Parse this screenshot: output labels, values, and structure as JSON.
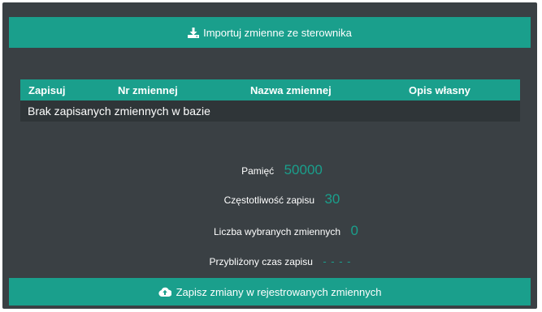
{
  "import_button": {
    "label": "Importuj zmienne ze sterownika",
    "icon": "download-icon"
  },
  "table": {
    "headers": [
      "Zapisuj",
      "Nr zmiennej",
      "Nazwa zmiennej",
      "Opis własny"
    ],
    "empty_message": "Brak zapisanych zmiennych w bazie"
  },
  "stats": {
    "memory": {
      "label": "Pamięć",
      "value": "50000"
    },
    "frequency": {
      "label": "Częstotliwość zapisu",
      "value": "30"
    },
    "selected_count": {
      "label": "Liczba wybranych zmiennych",
      "value": "0"
    },
    "approx_time": {
      "label": "Przybliżony czas zapisu",
      "value": "- - - -"
    }
  },
  "save_button": {
    "label": "Zapisz zmiany w rejestrowanych zmiennych",
    "icon": "cloud-upload-icon"
  },
  "colors": {
    "accent": "#1a9f8c",
    "panel": "#3a4044",
    "row": "#2f3538"
  }
}
